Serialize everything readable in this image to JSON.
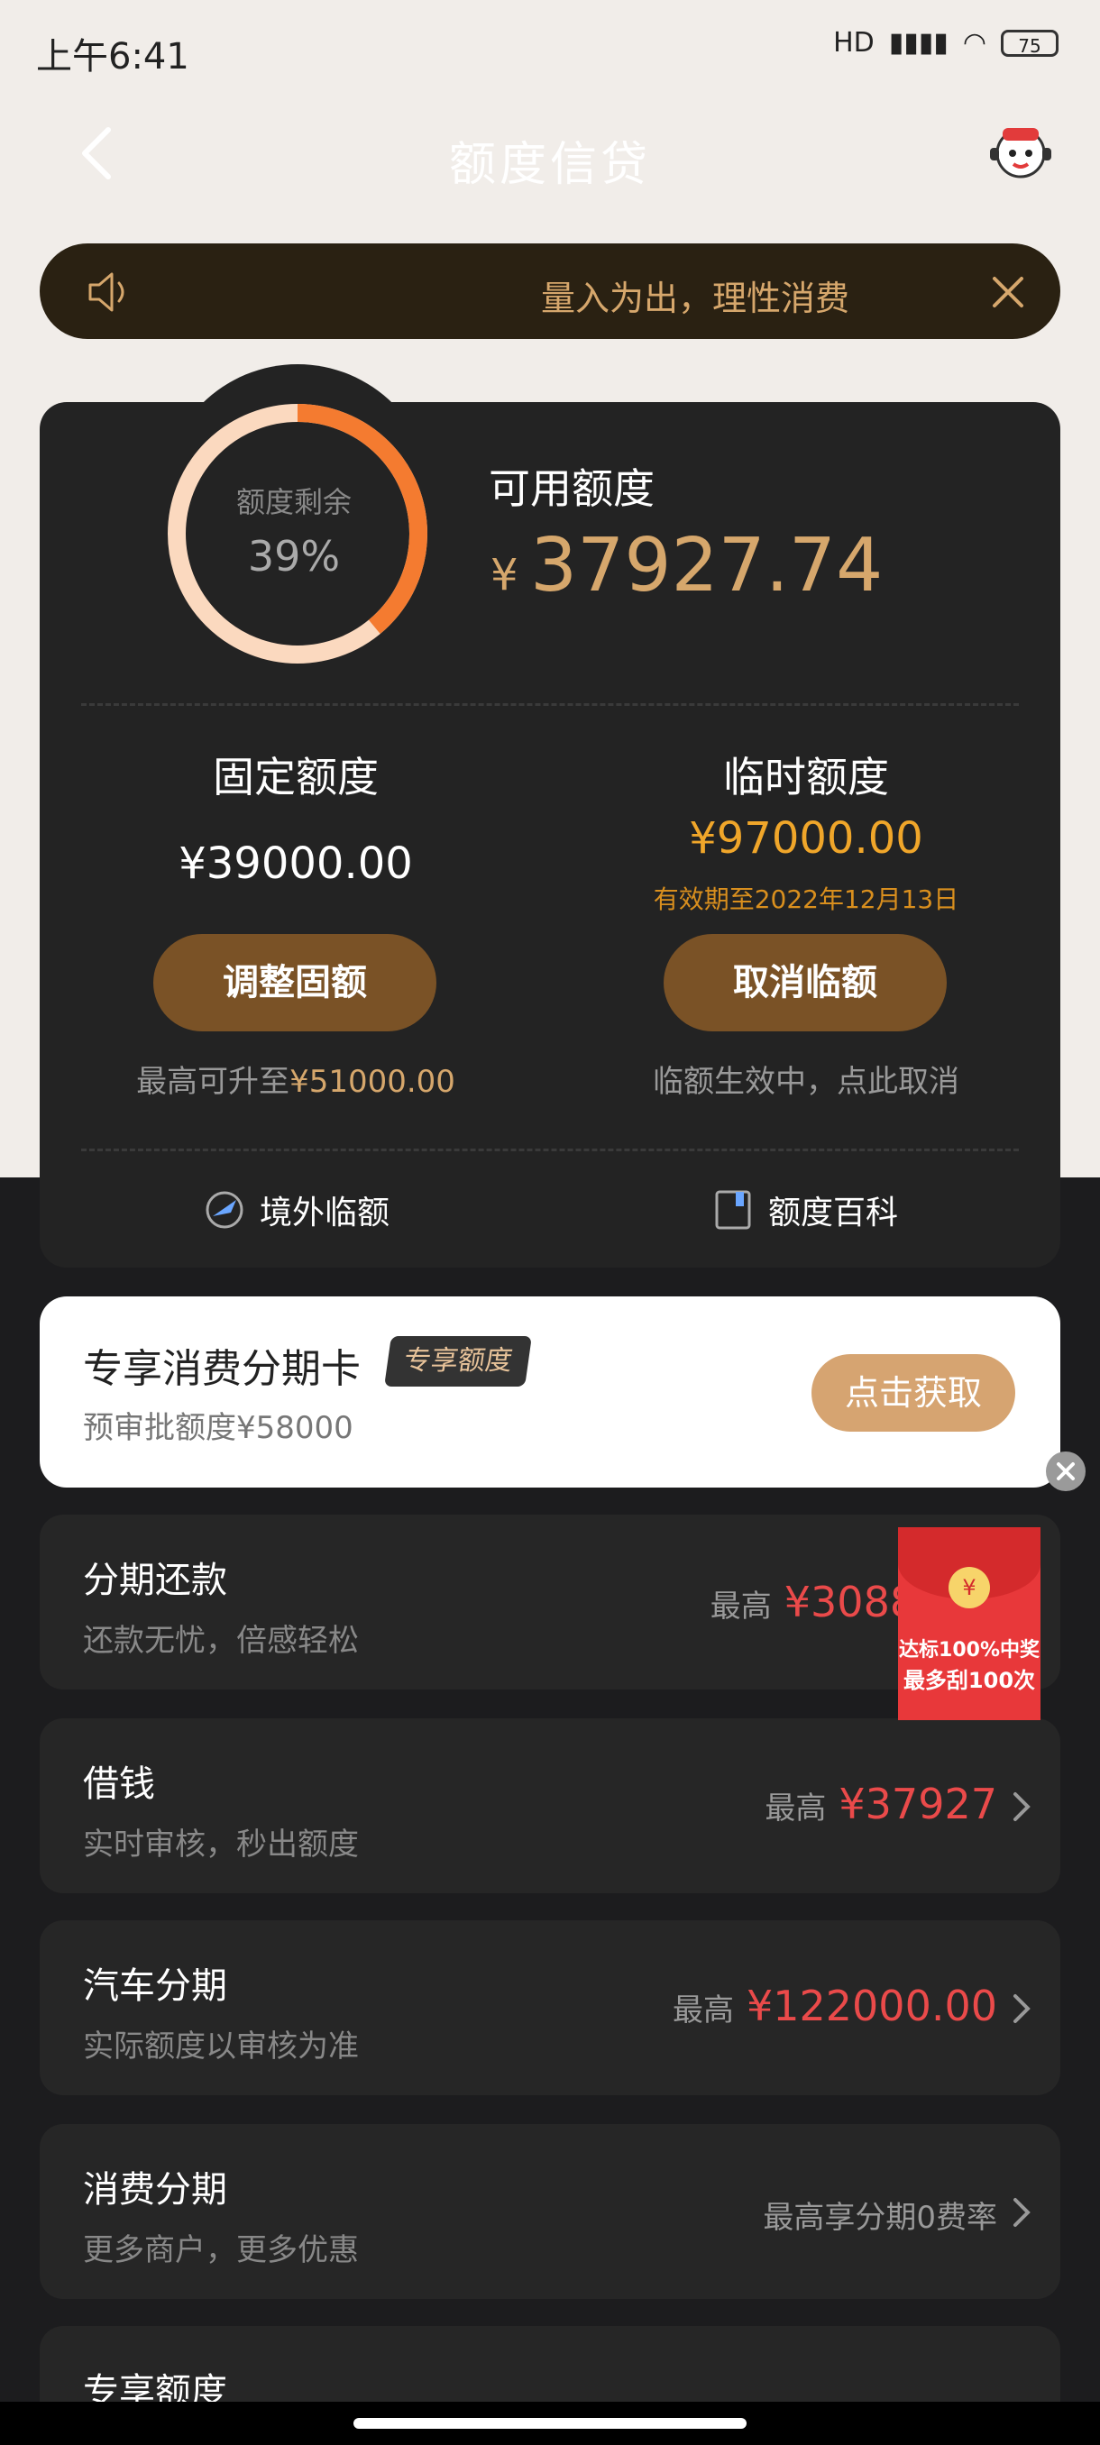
{
  "status_bar": {
    "time": "上午6:41",
    "network": "HD",
    "battery": "75"
  },
  "header": {
    "title": "额度信贷"
  },
  "notice": {
    "text": "量入为出，理性消费"
  },
  "credit": {
    "ring_label": "额度剩余",
    "ring_percent": "39%",
    "remaining_fraction": 0.39,
    "available_label": "可用额度",
    "currency": "¥",
    "available_value": "37927.74",
    "fixed": {
      "title": "固定额度",
      "value": "¥39000.00",
      "button": "调整固额",
      "hint_prefix": "最高可升至",
      "hint_value": "¥51000.00"
    },
    "temp": {
      "title": "临时额度",
      "value": "¥97000.00",
      "validity": "有效期至2022年12月13日",
      "button": "取消临额",
      "hint": "临额生效中，点此取消"
    },
    "links": {
      "overseas": "境外临额",
      "wiki": "额度百科"
    }
  },
  "promo": {
    "title": "专享消费分期卡",
    "badge": "专享额度",
    "sub": "预审批额度¥58000",
    "button": "点击获取"
  },
  "red_packet": {
    "line1": "达标100%中奖",
    "line2": "最多刮100次",
    "coin": "¥"
  },
  "services": [
    {
      "title": "分期还款",
      "sub": "还款无忧，倍感轻松",
      "prefix": "最高",
      "amount": "¥30889."
    },
    {
      "title": "借钱",
      "sub": "实时审核，秒出额度",
      "prefix": "最高",
      "amount": "¥37927"
    },
    {
      "title": "汽车分期",
      "sub": "实际额度以审核为准",
      "prefix": "最高",
      "amount": "¥122000.00"
    },
    {
      "title": "消费分期",
      "sub": "更多商户，更多优惠",
      "prefix": "最高享分期0费率",
      "amount": ""
    },
    {
      "title": "专享额度",
      "sub": "",
      "prefix": "",
      "amount": ""
    }
  ],
  "colors": {
    "accent_gold": "#d6a76c",
    "ring_orange": "#f47b30",
    "ring_light": "#fbd9bf",
    "amount_red": "#ea4a4a",
    "button_brown": "#7a5226"
  }
}
